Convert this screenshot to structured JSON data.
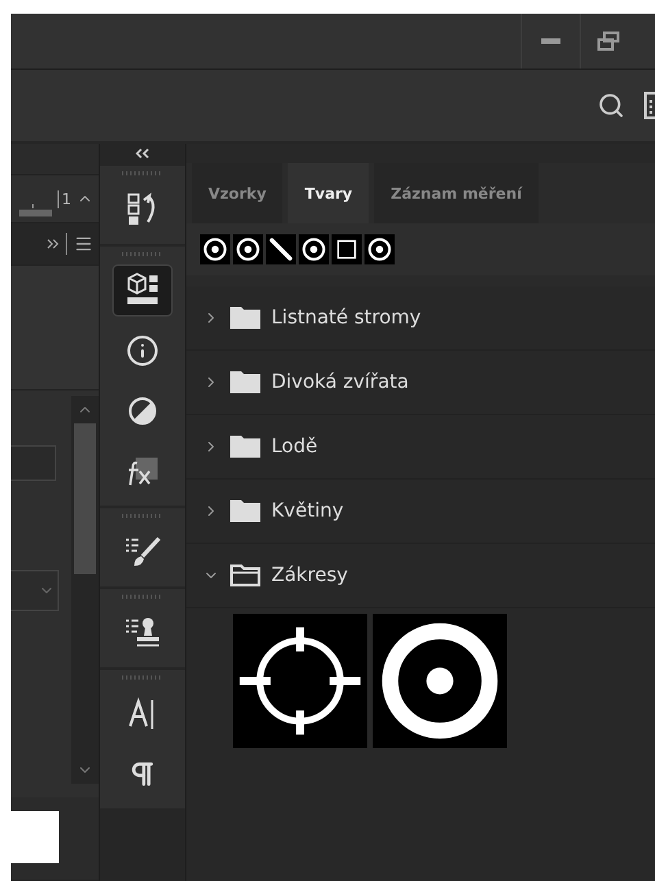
{
  "left_panel": {
    "ruler_value": "1"
  },
  "tool_strip": {
    "groups": [
      {
        "tools": [
          {
            "kind": "history",
            "selected": false
          }
        ]
      },
      {
        "tools": [
          {
            "kind": "cube",
            "selected": true
          },
          {
            "kind": "info",
            "selected": false
          },
          {
            "kind": "adjustments",
            "selected": false
          },
          {
            "kind": "fx",
            "selected": false
          }
        ]
      },
      {
        "tools": [
          {
            "kind": "brush",
            "selected": false
          }
        ]
      },
      {
        "tools": [
          {
            "kind": "stamp",
            "selected": false
          }
        ]
      },
      {
        "tools": [
          {
            "kind": "character",
            "selected": false
          },
          {
            "kind": "paragraph",
            "selected": false
          }
        ]
      }
    ]
  },
  "panel": {
    "tabs": [
      {
        "label": "Vzorky",
        "selected": false
      },
      {
        "label": "Tvary",
        "selected": true
      },
      {
        "label": "Záznam měření",
        "selected": false
      }
    ],
    "recent_shapes": [
      {
        "kind": "target"
      },
      {
        "kind": "target"
      },
      {
        "kind": "line"
      },
      {
        "kind": "target"
      },
      {
        "kind": "square"
      },
      {
        "kind": "target"
      }
    ],
    "folders": [
      {
        "name": "Listnaté stromy",
        "expanded": false
      },
      {
        "name": "Divoká zvířata",
        "expanded": false
      },
      {
        "name": "Lodě",
        "expanded": false
      },
      {
        "name": "Květiny",
        "expanded": false
      },
      {
        "name": "Zákresy",
        "expanded": true,
        "shapes": [
          {
            "kind": "crosshair"
          },
          {
            "kind": "ring"
          }
        ]
      }
    ]
  }
}
